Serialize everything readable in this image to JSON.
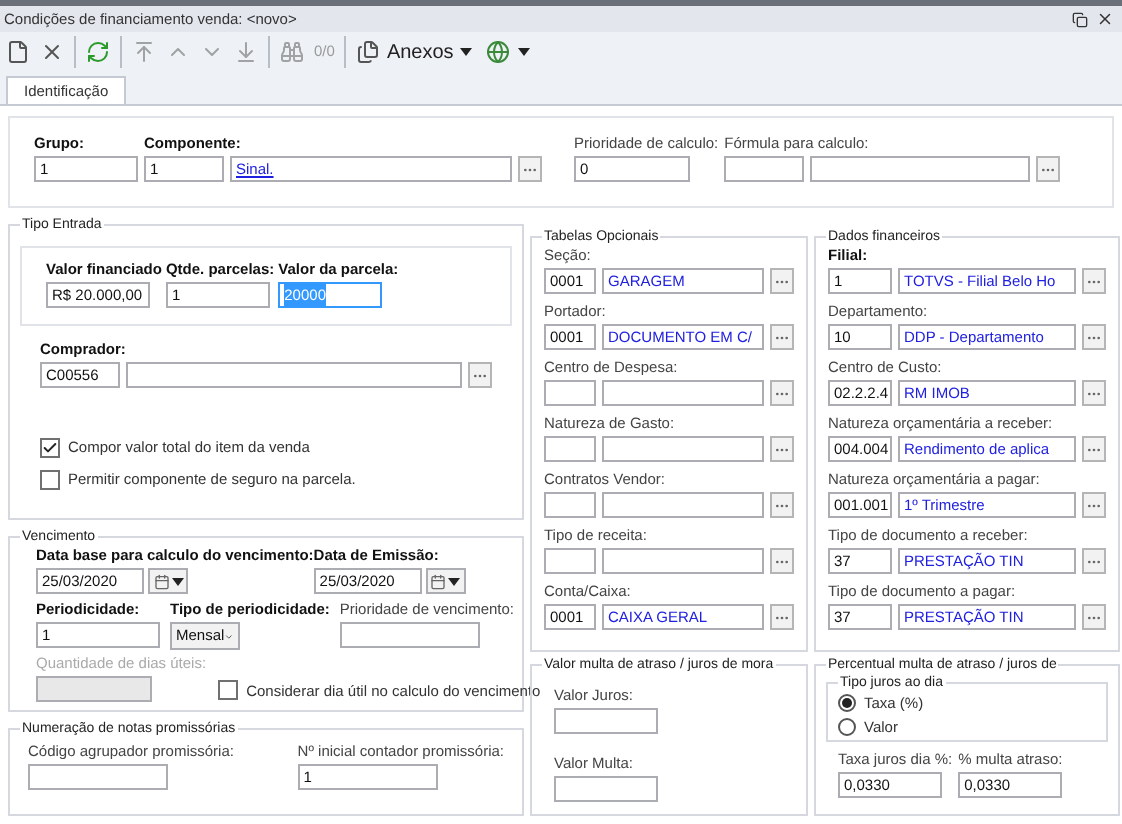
{
  "window": {
    "title": "Condições de financiamento venda: <novo>"
  },
  "toolbar": {
    "record_counter": "0/0",
    "attachments_button": "Anexos"
  },
  "tabs": [
    {
      "label": "Identificação",
      "selected": true
    }
  ],
  "identification": {
    "grupo": {
      "label": "Grupo:",
      "value": "1",
      "required": true
    },
    "componente": {
      "label": "Componente:",
      "code": "1",
      "description": "Sinal.",
      "required": true
    },
    "prioridade": {
      "label": "Prioridade de calculo:",
      "value": "0",
      "required": false
    },
    "formula": {
      "label": "Fórmula para calculo:"
    }
  },
  "tipo_entrada": {
    "title": "Tipo Entrada",
    "valor_financiado": {
      "label": "Valor financiado",
      "value": "R$ 20.000,00",
      "required": true
    },
    "qtde_parcelas": {
      "label": "Qtde. parcelas:",
      "value": "1",
      "required": true
    },
    "valor_parcela": {
      "label": "Valor da parcela:",
      "value": "20000",
      "required": true,
      "focused": true
    },
    "comprador": {
      "label": "Comprador:",
      "code": "C00556",
      "required": true
    },
    "options": [
      {
        "label": "Compor valor total do item da venda",
        "checked": true
      },
      {
        "label": "Permitir componente de seguro na parcela.",
        "checked": false
      }
    ]
  },
  "vencimento": {
    "title": "Vencimento",
    "data_base": {
      "label": "Data base para calculo do vencimento:",
      "value": "25/03/2020",
      "required": true
    },
    "data_emissao": {
      "label": "Data de Emissão:",
      "value": "25/03/2020",
      "required": true
    },
    "periodicidade": {
      "label": "Periodicidade:",
      "value": "1",
      "required": true
    },
    "tipo_periodicidade": {
      "label": "Tipo de periodicidade:",
      "value": "Mensal",
      "required": true
    },
    "prioridade_vencimento": {
      "label": "Prioridade de vencimento:",
      "required": false
    },
    "dias_uteis": {
      "label": "Quantidade de dias úteis:",
      "disabled": true
    },
    "considerar_dia_util": {
      "label": "Considerar dia útil no calculo do vencimento",
      "checked": false
    }
  },
  "promissorias": {
    "title": "Numeração de notas promissórias",
    "codigo_agrupador": {
      "label": "Código agrupador promissória:"
    },
    "contador_inicial": {
      "label": "Nº inicial contador promissória:",
      "value": "1"
    }
  },
  "tabelas_opcionais": {
    "title": "Tabelas Opcionais",
    "lookups": [
      {
        "label": "Seção:",
        "code": "0001",
        "description": "GARAGEM",
        "required": false
      },
      {
        "label": "Portador:",
        "code": "0001",
        "description": "DOCUMENTO EM C/",
        "required": false
      },
      {
        "label": "Centro de Despesa:",
        "required": false
      },
      {
        "label": "Natureza de Gasto:",
        "required": false
      },
      {
        "label": "Contratos Vendor:",
        "required": false
      },
      {
        "label": "Tipo de receita:",
        "required": false
      },
      {
        "label": "Conta/Caixa:",
        "code": "0001",
        "description": "CAIXA GERAL",
        "required": false
      }
    ]
  },
  "dados_financeiros": {
    "title": "Dados financeiros",
    "lookups": [
      {
        "label": "Filial:",
        "code": "1",
        "description": "TOTVS - Filial Belo Ho",
        "required": true
      },
      {
        "label": "Departamento:",
        "code": "10",
        "description": "DDP - Departamento",
        "required": false
      },
      {
        "label": "Centro de Custo:",
        "code": "02.2.2.4",
        "description": "RM IMOB",
        "required": false
      },
      {
        "label": "Natureza orçamentária a receber:",
        "code": "004.004",
        "description": "Rendimento de aplica",
        "required": false
      },
      {
        "label": "Natureza orçamentária a pagar:",
        "code": "001.001",
        "description": "1º Trimestre",
        "required": false
      },
      {
        "label": "Tipo de documento a receber:",
        "code": "37",
        "description": "PRESTAÇÃO TIN",
        "required": false
      },
      {
        "label": "Tipo de documento a pagar:",
        "code": "37",
        "description": "PRESTAÇÃO TIN",
        "required": false
      }
    ]
  },
  "valor_multa": {
    "title": "Valor multa de atraso / juros de mora",
    "fields": [
      {
        "label": "Valor Juros:"
      },
      {
        "label": "Valor Multa:"
      }
    ]
  },
  "percentual_multa": {
    "title": "Percentual multa de atraso / juros de",
    "tipo_juros": {
      "title": "Tipo juros ao dia",
      "options": [
        {
          "label": "Taxa (%)",
          "selected": true
        },
        {
          "label": "Valor",
          "selected": false
        }
      ]
    },
    "fields": [
      {
        "label": "Taxa juros dia %:",
        "value": "0,0330"
      },
      {
        "label": "% multa atraso:",
        "value": "0,0330"
      }
    ]
  }
}
